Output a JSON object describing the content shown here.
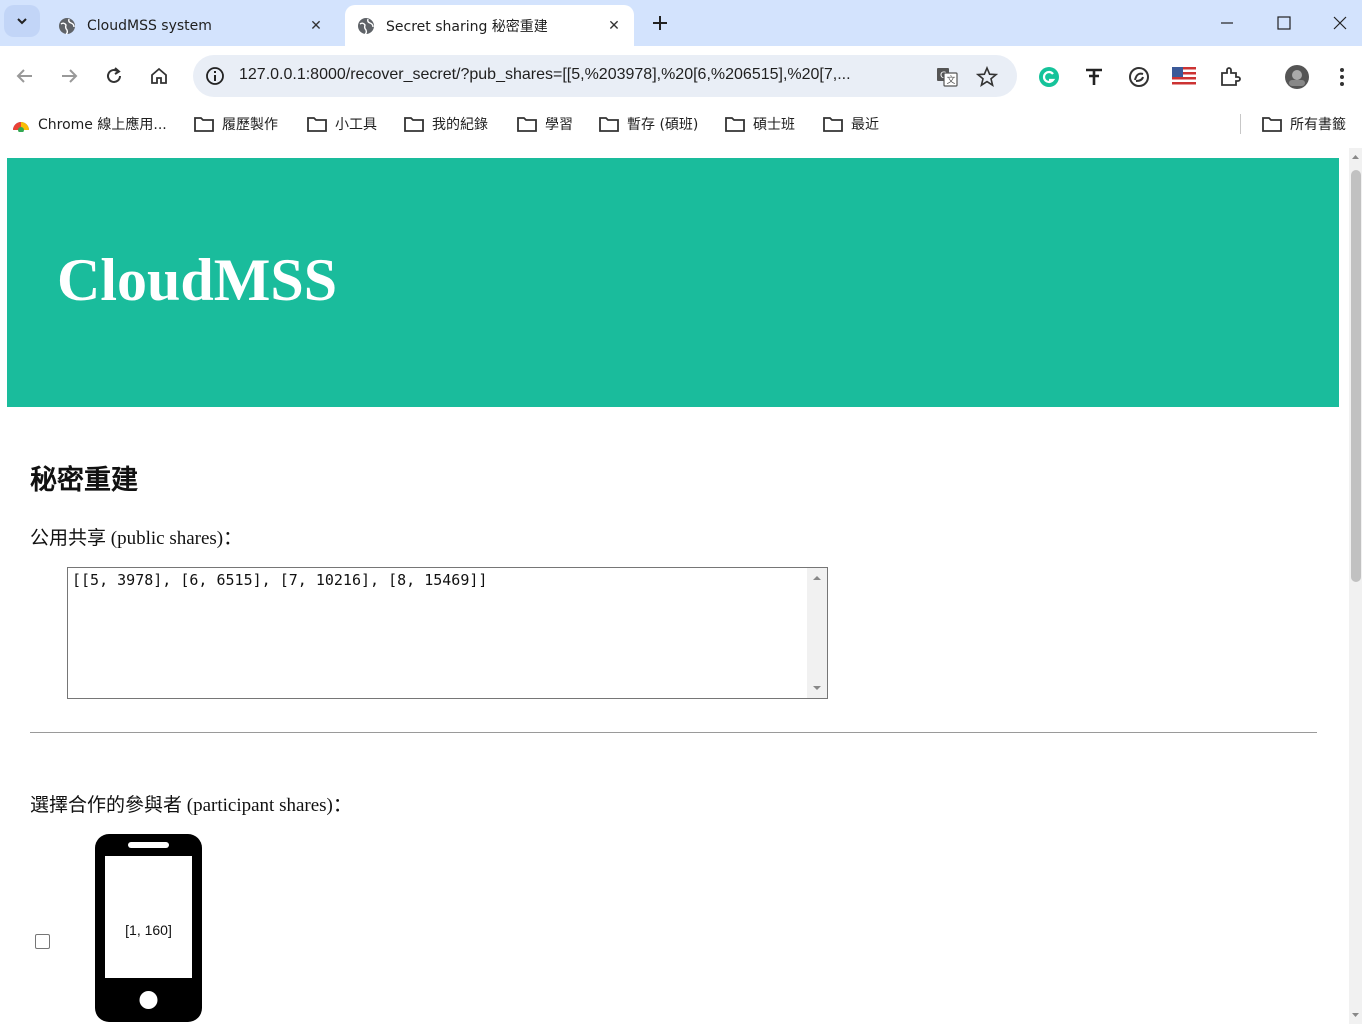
{
  "tabs": [
    {
      "title": "CloudMSS system",
      "active": false
    },
    {
      "title": "Secret sharing 秘密重建",
      "active": true
    }
  ],
  "toolbar": {
    "url": "127.0.0.1:8000/recover_secret/?pub_shares=[[5,%203978],%20[6,%206515],%20[7,..."
  },
  "bookmarks": [
    {
      "label": "Chrome 線上應用..."
    },
    {
      "label": "履歷製作"
    },
    {
      "label": "小工具"
    },
    {
      "label": "我的紀錄"
    },
    {
      "label": "學習"
    },
    {
      "label": "暫存 (碩班)"
    },
    {
      "label": "碩士班"
    },
    {
      "label": "最近"
    }
  ],
  "bookmarks_all": "所有書籤",
  "page": {
    "banner_title": "CloudMSS",
    "heading": "秘密重建",
    "public_shares_label": "公用共享 (public shares)：",
    "public_shares_value": "[[5, 3978], [6, 6515], [7, 10216], [8, 15469]]",
    "participants_label": "選擇合作的參與者 (participant shares)：",
    "participants": [
      {
        "share": "[1, 160]",
        "checked": false
      }
    ]
  },
  "colors": {
    "banner": "#1abc9c",
    "tabstrip": "#d3e3fd"
  }
}
